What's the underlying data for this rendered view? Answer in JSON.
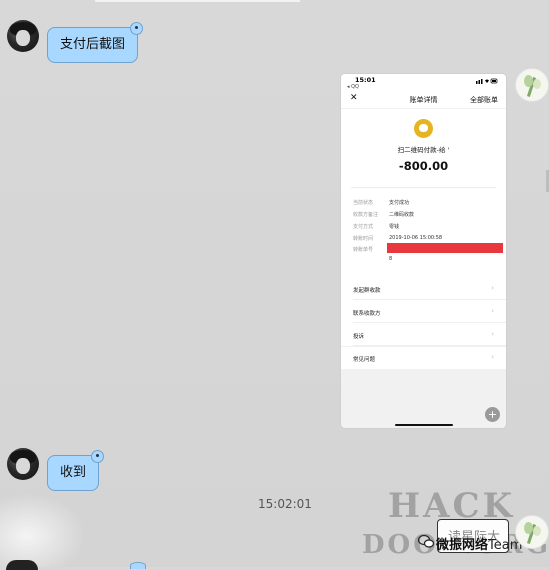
{
  "chat": {
    "messages": [
      {
        "text": "支付后截图"
      },
      {
        "text": "收到"
      }
    ],
    "timestamp": "15:02:01"
  },
  "screenshot": {
    "status_time": "15:01",
    "status_back": "◂ QQ",
    "nav_close": "✕",
    "nav_title": "账单详情",
    "nav_all": "全部账单",
    "merchant": "扫二维码付款-给 '",
    "amount": "-800.00",
    "details": [
      {
        "label": "当前状态",
        "value": "支付成功"
      },
      {
        "label": "收款方备注",
        "value": "二维码收款"
      },
      {
        "label": "支付方式",
        "value": "零钱"
      },
      {
        "label": "转账时间",
        "value": "2019-10-06 15:00:58"
      },
      {
        "label": "转账单号",
        "value": ""
      }
    ],
    "transfer_no_tail": "8",
    "links": [
      "发起群收款",
      "联系收款方",
      "投诉",
      "常见问题"
    ],
    "zoom_symbol": "+"
  },
  "watermark": {
    "line1": "HACK",
    "line2": "DOOR.ORG",
    "box_text": "读星际大",
    "brand": "微振网络",
    "brand_tail": "Team"
  },
  "colors": {
    "bubble": "#a8d8ff",
    "bubble_border": "#6fa2cc",
    "redaction": "#e8383d",
    "wechat_gold": "#e6b422"
  }
}
